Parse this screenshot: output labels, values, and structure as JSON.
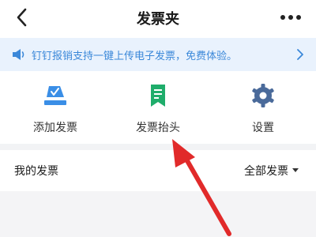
{
  "header": {
    "title": "发票夹",
    "back_icon": "chevron-left-icon",
    "more_icon": "more-dots-icon"
  },
  "banner": {
    "icon": "speaker-icon",
    "text": "钉钉报销支持一键上传电子发票，免费体验。",
    "chevron_icon": "chevron-right-icon",
    "color": "#3b88d9",
    "background": "#e9f2fd"
  },
  "actions": [
    {
      "label": "添加发票",
      "icon": "add-invoice-icon",
      "color": "#3a8ee6"
    },
    {
      "label": "发票抬头",
      "icon": "invoice-title-bookmark-icon",
      "color": "#1fad6b"
    },
    {
      "label": "设置",
      "icon": "gear-icon",
      "color": "#4a6a9a"
    }
  ],
  "my_invoices": {
    "title": "我的发票",
    "filter": {
      "selected": "全部发票",
      "icon": "caret-down-icon"
    }
  },
  "annotation": {
    "type": "red-arrow",
    "target": "发票抬头",
    "color": "#e12a2a"
  }
}
